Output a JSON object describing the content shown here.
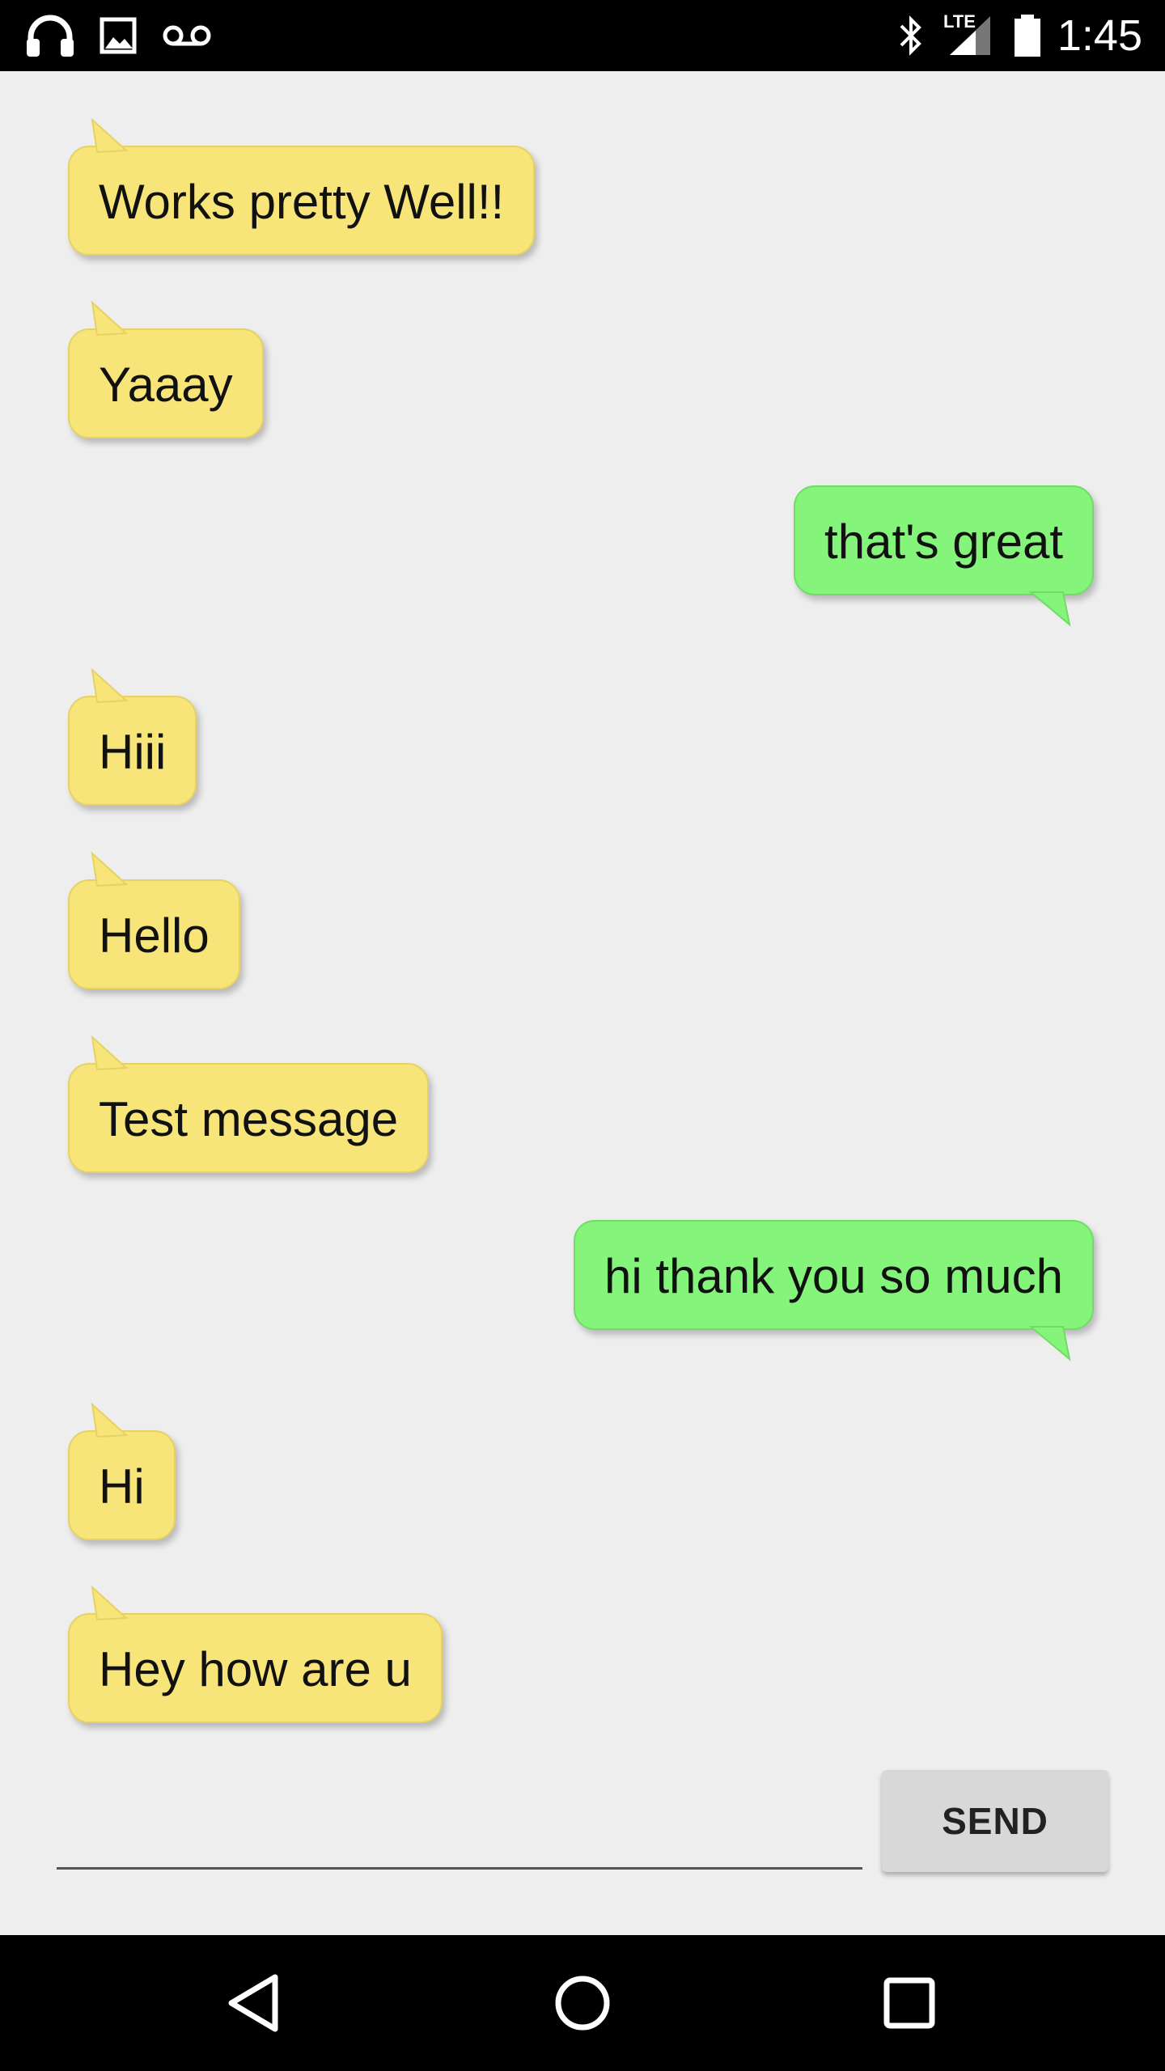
{
  "status_bar": {
    "time": "1:45",
    "network_type": "LTE",
    "left_icons": [
      "headphones-icon",
      "image-notification-icon",
      "voicemail-icon"
    ],
    "right_icons": [
      "bluetooth-icon",
      "cell-signal-icon",
      "battery-icon"
    ]
  },
  "colors": {
    "received_bubble": "#f8e57a",
    "sent_bubble": "#84f57a",
    "background": "#eeeeee",
    "bars": "#000000"
  },
  "messages": [
    {
      "text": "Works pretty Well!!",
      "direction": "received"
    },
    {
      "text": "Yaaay",
      "direction": "received"
    },
    {
      "text": "that's great",
      "direction": "sent"
    },
    {
      "text": "Hiii",
      "direction": "received"
    },
    {
      "text": "Hello",
      "direction": "received"
    },
    {
      "text": "Test message",
      "direction": "received"
    },
    {
      "text": "hi thank you so much",
      "direction": "sent"
    },
    {
      "text": "Hi",
      "direction": "received"
    },
    {
      "text": "Hey how are u",
      "direction": "received"
    }
  ],
  "composer": {
    "input_value": "",
    "send_label": "SEND"
  },
  "nav_bar": {
    "buttons": [
      "back-icon",
      "home-icon",
      "recents-icon"
    ]
  }
}
